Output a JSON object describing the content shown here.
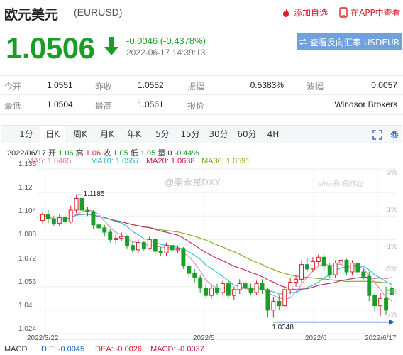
{
  "header": {
    "title": "欧元美元",
    "code": "(EURUSD)",
    "add_favorite": "添加自选",
    "open_app": "在APP中查看"
  },
  "quote": {
    "price": "1.0506",
    "change": "-0.0046 (-0.4378%)",
    "time": "2022-06-17 14:39:13",
    "reverse_button": "查看反向汇率 USDEUR",
    "down_color": "#1a9e29"
  },
  "stats": {
    "rows": [
      [
        {
          "label": "今开",
          "value": "1.0551"
        },
        {
          "label": "昨收",
          "value": "1.0552"
        },
        {
          "label": "振幅",
          "value": "0.5383%"
        },
        {
          "label": "波幅",
          "value": "0.0057"
        }
      ],
      [
        {
          "label": "最低",
          "value": "1.0504"
        },
        {
          "label": "最高",
          "value": "1.0561"
        },
        {
          "label": "报价",
          "value": ""
        },
        {
          "label": "",
          "value": "Windsor Brokers"
        }
      ]
    ]
  },
  "tabs": [
    "1分",
    "日K",
    "周K",
    "月K",
    "年K",
    "5分",
    "15分",
    "30分",
    "60分",
    "4H"
  ],
  "active_tab": "日K",
  "toolbar_icons": [
    "fullscreen-icon",
    "settings-icon"
  ],
  "kline_info": {
    "date": "2022/06/17",
    "open_label": "开",
    "open": "1.06",
    "high_label": "高",
    "high": "1.06",
    "close_label": "收",
    "close": "1.05",
    "low_label": "低",
    "low": "1.05",
    "vol_label": "量",
    "vol": "0",
    "pct": "-0.44%"
  },
  "ma_legend": [
    {
      "text": "MA5: 1.0465",
      "color": "#e87fb0"
    },
    {
      "text": "MA10: 1.0557",
      "color": "#29b3d6"
    },
    {
      "text": "MA20: 1.0638",
      "color": "#c2185b"
    },
    {
      "text": "MA30: 1.0591",
      "color": "#7aa515"
    }
  ],
  "watermarks": [
    "@秦永昆DXY",
    "sina新浪财经"
  ],
  "macd": [
    {
      "text": "MACD",
      "color": "#333"
    },
    {
      "text": "DIF: -0.0045",
      "color": "#1e5fbf"
    },
    {
      "text": "DEA: -0.0026",
      "color": "#d4232b"
    },
    {
      "text": "MACD: -0.0037",
      "color": "#c2185b"
    }
  ],
  "chart_data": {
    "type": "candlestick",
    "yaxis_ticks": [
      "1.136",
      "1.12",
      "1.104",
      "1.088",
      "1.072",
      "1.056",
      "1.04",
      "1.024"
    ],
    "ylim": [
      1.024,
      1.136
    ],
    "pct_ticks": [
      "3%",
      "1%",
      "-1%",
      "-3%",
      "-5%",
      "-7%"
    ],
    "x_labels": [
      "2022/3/22",
      "2022/5",
      "2022/6",
      "2022/6/17"
    ],
    "annotations": [
      {
        "text": "1.1185",
        "value": 1.1185
      },
      {
        "text": "1.0348",
        "value": 1.0348
      }
    ],
    "up_color": "#d4232b",
    "down_color": "#1a9e29",
    "candles": [
      [
        1.101,
        1.105,
        1.107,
        1.099
      ],
      [
        1.105,
        1.102,
        1.108,
        1.099
      ],
      [
        1.102,
        1.099,
        1.104,
        1.097
      ],
      [
        1.099,
        1.103,
        1.105,
        1.097
      ],
      [
        1.103,
        1.1,
        1.105,
        1.098
      ],
      [
        1.1,
        1.108,
        1.111,
        1.099
      ],
      [
        1.108,
        1.116,
        1.1185,
        1.106
      ],
      [
        1.116,
        1.108,
        1.117,
        1.105
      ],
      [
        1.108,
        1.107,
        1.11,
        1.104
      ],
      [
        1.107,
        1.098,
        1.108,
        1.095
      ],
      [
        1.098,
        1.096,
        1.1,
        1.094
      ],
      [
        1.096,
        1.093,
        1.098,
        1.09
      ],
      [
        1.093,
        1.088,
        1.095,
        1.086
      ],
      [
        1.088,
        1.089,
        1.092,
        1.085
      ],
      [
        1.089,
        1.09,
        1.093,
        1.087
      ],
      [
        1.09,
        1.084,
        1.091,
        1.082
      ],
      [
        1.084,
        1.081,
        1.087,
        1.079
      ],
      [
        1.081,
        1.086,
        1.088,
        1.079
      ],
      [
        1.086,
        1.082,
        1.087,
        1.08
      ],
      [
        1.082,
        1.088,
        1.09,
        1.081
      ],
      [
        1.088,
        1.08,
        1.089,
        1.078
      ],
      [
        1.08,
        1.079,
        1.083,
        1.077
      ],
      [
        1.079,
        1.084,
        1.086,
        1.077
      ],
      [
        1.084,
        1.081,
        1.085,
        1.079
      ],
      [
        1.081,
        1.082,
        1.084,
        1.079
      ],
      [
        1.082,
        1.07,
        1.083,
        1.068
      ],
      [
        1.07,
        1.065,
        1.072,
        1.062
      ],
      [
        1.065,
        1.062,
        1.068,
        1.059
      ],
      [
        1.062,
        1.055,
        1.064,
        1.052
      ],
      [
        1.055,
        1.05,
        1.058,
        1.048
      ],
      [
        1.05,
        1.055,
        1.057,
        1.048
      ],
      [
        1.055,
        1.052,
        1.058,
        1.05
      ],
      [
        1.052,
        1.058,
        1.06,
        1.05
      ],
      [
        1.058,
        1.05,
        1.06,
        1.048
      ],
      [
        1.05,
        1.054,
        1.056,
        1.047
      ],
      [
        1.054,
        1.058,
        1.061,
        1.051
      ],
      [
        1.058,
        1.055,
        1.06,
        1.053
      ],
      [
        1.055,
        1.052,
        1.058,
        1.05
      ],
      [
        1.052,
        1.058,
        1.06,
        1.05
      ],
      [
        1.058,
        1.054,
        1.061,
        1.051
      ],
      [
        1.054,
        1.04,
        1.055,
        1.035
      ],
      [
        1.04,
        1.046,
        1.049,
        1.0348
      ],
      [
        1.046,
        1.043,
        1.05,
        1.04
      ],
      [
        1.043,
        1.054,
        1.057,
        1.042
      ],
      [
        1.054,
        1.059,
        1.062,
        1.051
      ],
      [
        1.059,
        1.061,
        1.064,
        1.056
      ],
      [
        1.061,
        1.071,
        1.074,
        1.059
      ],
      [
        1.071,
        1.068,
        1.076,
        1.066
      ],
      [
        1.068,
        1.073,
        1.076,
        1.066
      ],
      [
        1.073,
        1.076,
        1.078,
        1.07
      ],
      [
        1.076,
        1.07,
        1.078,
        1.067
      ],
      [
        1.07,
        1.064,
        1.072,
        1.062
      ],
      [
        1.064,
        1.072,
        1.074,
        1.062
      ],
      [
        1.072,
        1.074,
        1.077,
        1.07
      ],
      [
        1.074,
        1.066,
        1.075,
        1.064
      ],
      [
        1.066,
        1.072,
        1.074,
        1.064
      ],
      [
        1.072,
        1.066,
        1.074,
        1.064
      ],
      [
        1.066,
        1.063,
        1.068,
        1.061
      ],
      [
        1.063,
        1.05,
        1.066,
        1.046
      ],
      [
        1.05,
        1.043,
        1.052,
        1.039
      ],
      [
        1.043,
        1.048,
        1.052,
        1.036
      ],
      [
        1.048,
        1.04,
        1.056,
        1.037
      ],
      [
        1.0551,
        1.0506,
        1.0561,
        1.0504
      ]
    ]
  }
}
